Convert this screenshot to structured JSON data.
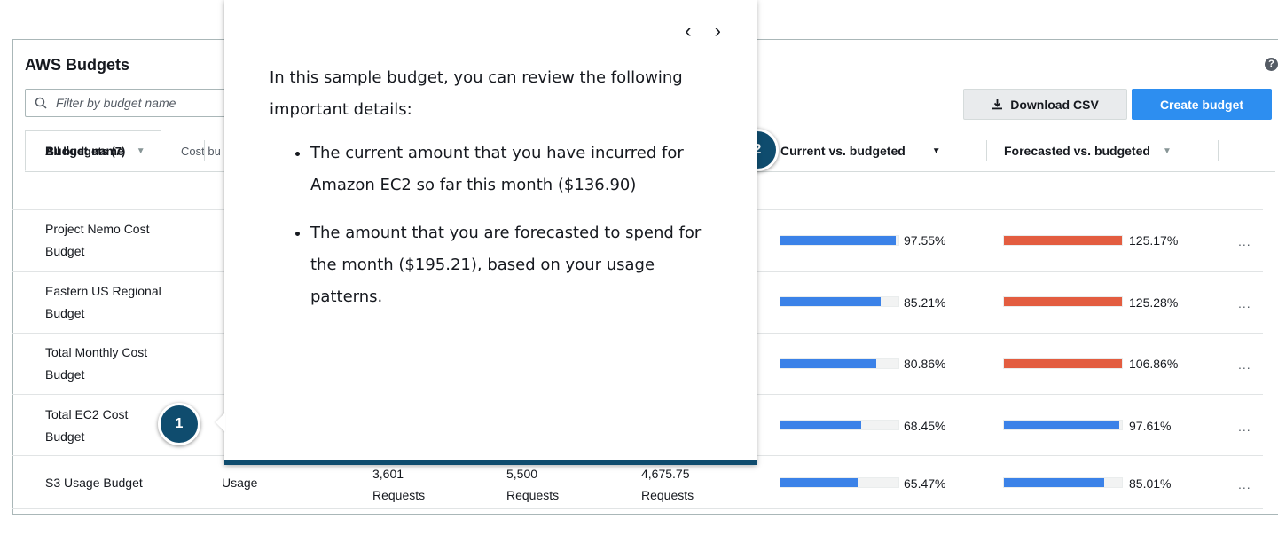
{
  "panel": {
    "title": "AWS Budgets",
    "help_icon": "?"
  },
  "toolbar": {
    "search_placeholder": "Filter by budget name",
    "download_label": "Download CSV",
    "create_label": "Create budget"
  },
  "tabs": [
    {
      "label": "All budgets (7)"
    },
    {
      "label": "Cost bu"
    }
  ],
  "table": {
    "headers": {
      "name": "Budget name",
      "current": "Current vs. budgeted",
      "forecast": "Forecasted vs. budgeted"
    },
    "rows": [
      {
        "name1": "Project Nemo Cost",
        "name2": "Budget",
        "type": "",
        "current_pct": "97.55%",
        "current_value": 97.55,
        "forecast_pct": "125.17%",
        "forecast_value": 125.17,
        "forecast_over": true
      },
      {
        "name1": "Eastern US Regional",
        "name2": "Budget",
        "type": "",
        "current_pct": "85.21%",
        "current_value": 85.21,
        "forecast_pct": "125.28%",
        "forecast_value": 125.28,
        "forecast_over": true
      },
      {
        "name1": "Total Monthly Cost",
        "name2": "Budget",
        "type": "",
        "current_pct": "80.86%",
        "current_value": 80.86,
        "forecast_pct": "106.86%",
        "forecast_value": 106.86,
        "forecast_over": true
      },
      {
        "name1": "Total EC2 Cost",
        "name2": "Budget",
        "type": "",
        "current_pct": "68.45%",
        "current_value": 68.45,
        "forecast_pct": "97.61%",
        "forecast_value": 97.61,
        "forecast_over": false
      },
      {
        "name1": "S3 Usage Budget",
        "name2": "",
        "type": "Usage",
        "c1a": "3,601",
        "c1b": "Requests",
        "c2a": "5,500",
        "c2b": "Requests",
        "c3a": "4,675.75",
        "c3b": "Requests",
        "current_pct": "65.47%",
        "current_value": 65.47,
        "forecast_pct": "85.01%",
        "forecast_value": 85.01,
        "forecast_over": false
      }
    ],
    "row_menu": "..."
  },
  "popover": {
    "prev": "‹",
    "next": "›",
    "intro": "In this sample budget, you can review the following important details:",
    "bullets": [
      "The current amount that you have incurred for Amazon EC2 so far this month ($136.90)",
      "The amount that you are forecasted to spend for the month ($195.21), based on your usage patterns."
    ]
  },
  "steps": {
    "step1": "1",
    "step2": "2"
  },
  "colors": {
    "current_bar": "#3b82e8",
    "forecast_over_bar": "#e35d40",
    "forecast_bar": "#3b82e8",
    "accent": "#2d8ef0",
    "badge": "#0f4c6e"
  }
}
